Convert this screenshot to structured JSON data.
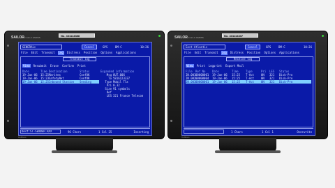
{
  "left_terminal": {
    "brand": "SAILOR",
    "brand_sub": "6110 mini-C GMDSS",
    "badge": "No. 431114388",
    "maker": "Cobham",
    "title": "GENERAL>",
    "cancel_label": "Cancel",
    "gps_label": "GPS",
    "bm_label": "BM-C",
    "clock": "10:26",
    "menu": [
      "File",
      "Edit",
      "Transmit",
      "Log",
      "Distress",
      "Position",
      "Options",
      "Applications"
    ],
    "active_menu": "Log",
    "panel_title": "Transmit log",
    "tabs": [
      "View",
      "Resubmit",
      "Erase",
      "Confirm",
      "Print"
    ],
    "active_tab": "View",
    "columns": [
      "Date",
      "Time",
      "Destination",
      "Status"
    ],
    "rows": [
      {
        "date": "19-Jan-06",
        "time": "15:25",
        "dest": "Maritex",
        "status": "ConfOK"
      },
      {
        "date": "19-Jan-06",
        "time": "15:23",
        "dest": "SafetyNet",
        "status": "ConfOK"
      },
      {
        "date": "19-Jan-06",
        "time": "15:25",
        "dest": "Inbound Station",
        "status": "Sending"
      }
    ],
    "selected_row": 2,
    "info_title": "Expanded information",
    "info": [
      {
        "key": "Msg",
        "value": "OUT.006"
      },
      {
        "key": "To",
        "value": "5816123337"
      },
      {
        "key": "Type",
        "value": "Mobil Tlx"
      },
      {
        "key": "Pri",
        "value": "0.32"
      },
      {
        "key": "Size",
        "value": "91 symbols"
      },
      {
        "key": "Ref",
        "value": ""
      },
      {
        "key": "LES",
        "value": "321 France Telecom"
      }
    ],
    "footer_field": "Dest:ST-SENDER.RAX",
    "footer_chars": "96 Chars",
    "footer_pos": "1 Col 25",
    "footer_mode": "Inserting"
  },
  "right_terminal": {
    "brand": "SAILOR",
    "brand_sub": "6110 mini-C GMDSS",
    "badge": "No. 431114337",
    "maker": "Cobham",
    "title": "East-Atlantic",
    "cancel_label": "Cancel",
    "gps_label": "GPS",
    "bm_label": "BM-C",
    "clock": "10:26",
    "menu": [
      "File",
      "Edit",
      "Transmit",
      "Log",
      "Distress",
      "Position",
      "Options",
      "Applications"
    ],
    "active_menu": "Log",
    "panel_title": "Receive log",
    "tabs": [
      "View",
      "Print",
      "Logprint",
      "Export Mail"
    ],
    "active_tab": "View",
    "columns": [
      "File",
      "Ref No",
      "Date",
      "Time",
      "Type",
      "Pri",
      "LES",
      "Status"
    ],
    "rows": [
      {
        "file": "IN.001",
        "ref": "00000001",
        "date": "19-Jan-06",
        "time": "15:25",
        "type": "T-Act",
        "pri": "0N",
        "les": "321",
        "status": "Disk-Pro"
      },
      {
        "file": "IN.002",
        "ref": "00000004",
        "date": "19-Jan-06",
        "time": "15:25",
        "type": "T-Act",
        "pri": "0N",
        "les": "321",
        "status": "Disk-Pro"
      },
      {
        "file": "IN.003",
        "ref": "00000001",
        "date": "19-Jan-06",
        "time": "15:25",
        "type": "T-Act",
        "pri": "0N",
        "les": "321",
        "status": "Disk-Pro"
      }
    ],
    "selected_row": 2,
    "footer_field": "",
    "footer_chars": "1 Chars",
    "footer_pos": "1 Col 1",
    "footer_mode": "Overwrite"
  }
}
